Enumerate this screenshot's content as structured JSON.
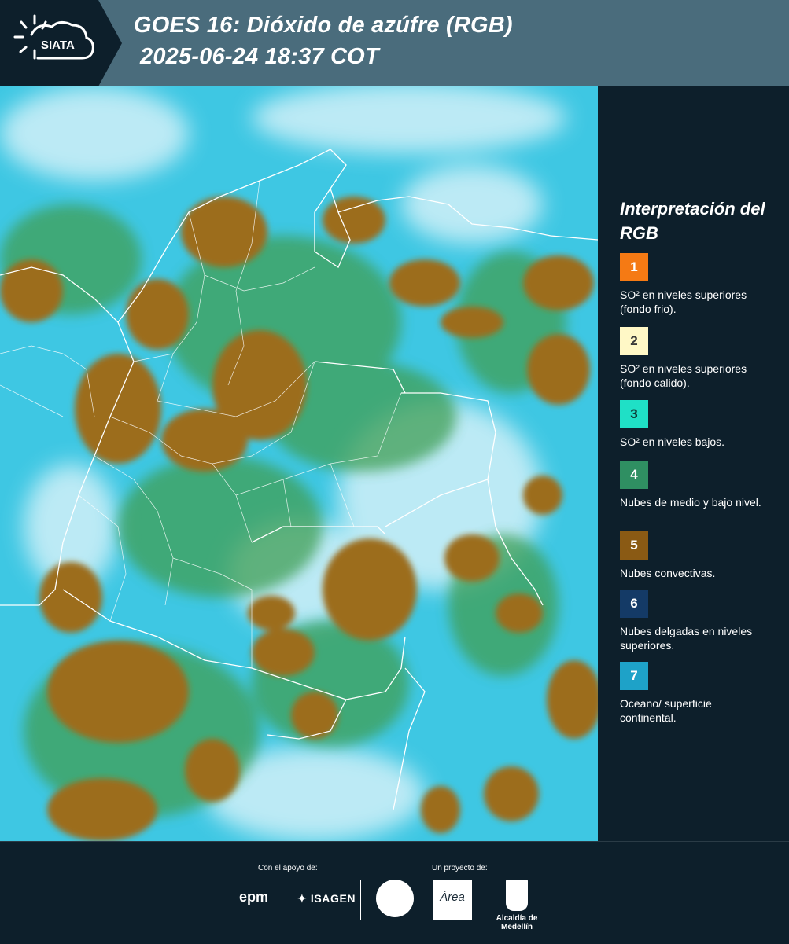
{
  "header": {
    "logo_text": "SIATA",
    "title_line1": "GOES 16: Dióxido de azúfre (RGB)",
    "title_line2": "2025-06-24 18:37 COT"
  },
  "legend": {
    "title": "Interpretación del RGB",
    "items": [
      {
        "number": "1",
        "color": "#f57a14",
        "text_color": "#ffffff",
        "description": "SO² en niveles superiores (fondo frio)."
      },
      {
        "number": "2",
        "color": "#fff8c6",
        "text_color": "#3a3a3a",
        "description": "SO² en niveles superiores (fondo calido)."
      },
      {
        "number": "3",
        "color": "#1fe0c6",
        "text_color": "#0d3a34",
        "description": "SO² en niveles bajos."
      },
      {
        "number": "4",
        "color": "#2f8f62",
        "text_color": "#ffffff",
        "description": "Nubes de medio y bajo nivel."
      },
      {
        "number": "5",
        "color": "#8a5a14",
        "text_color": "#ffffff",
        "description": "Nubes convectivas."
      },
      {
        "number": "6",
        "color": "#143a66",
        "text_color": "#ffffff",
        "description": "Nubes delgadas en niveles superiores."
      },
      {
        "number": "7",
        "color": "#1ea2c8",
        "text_color": "#ffffff",
        "description": "Oceano/ superficie continental."
      }
    ]
  },
  "footer": {
    "support_label": "Con el apoyo de:",
    "project_label": "Un proyecto de:",
    "epm": "epm",
    "isagen": "ISAGEN",
    "area_text": "Área",
    "alcaldia": "Alcaldía de Medellín"
  },
  "map_colors": {
    "ocean": "#3ec7e3",
    "cloud_high": "#e6f6fb",
    "convective": "#9c6d1c",
    "mid_low": "#3f9f55",
    "border": "#ffffff"
  }
}
